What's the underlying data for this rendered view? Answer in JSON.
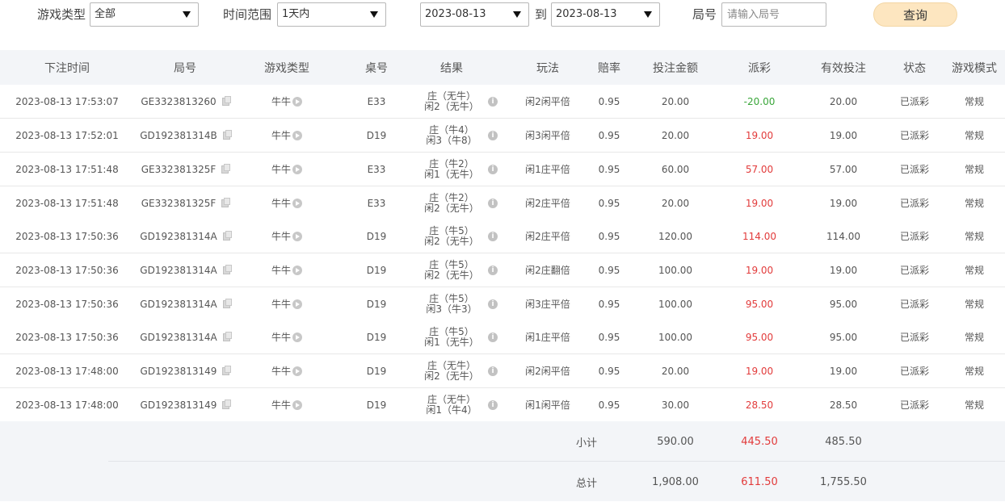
{
  "filters": {
    "game_type_label": "游戏类型",
    "game_type_value": "全部",
    "time_range_label": "时间范围",
    "time_range_value": "1天内",
    "date_from": "2023-08-13",
    "to_label": "到",
    "date_to": "2023-08-13",
    "round_label": "局号",
    "round_placeholder": "请输入局号",
    "query_button": "查询"
  },
  "table": {
    "headers": {
      "time": "下注时间",
      "round": "局号",
      "game": "游戏类型",
      "table": "桌号",
      "result": "结果",
      "play": "玩法",
      "odds": "赔率",
      "bet": "投注金额",
      "payout": "派彩",
      "valid": "有效投注",
      "status": "状态",
      "mode": "游戏模式"
    },
    "rows": [
      {
        "time": "2023-08-13 17:53:07",
        "round": "GE3323813260",
        "game": "牛牛",
        "table": "E33",
        "result1": "庄（无牛）",
        "result2": "闲2（无牛）",
        "play": "闲2闲平倍",
        "odds": "0.95",
        "bet": "20.00",
        "payout": "-20.00",
        "valid": "20.00",
        "status": "已派彩",
        "mode": "常规"
      },
      {
        "time": "2023-08-13 17:52:01",
        "round": "GD192381314B",
        "game": "牛牛",
        "table": "D19",
        "result1": "庄（牛4）",
        "result2": "闲3（牛8）",
        "play": "闲3闲平倍",
        "odds": "0.95",
        "bet": "20.00",
        "payout": "19.00",
        "valid": "19.00",
        "status": "已派彩",
        "mode": "常规"
      },
      {
        "time": "2023-08-13 17:51:48",
        "round": "GE332381325F",
        "game": "牛牛",
        "table": "E33",
        "result1": "庄（牛2）",
        "result2": "闲1（无牛）",
        "play": "闲1庄平倍",
        "odds": "0.95",
        "bet": "60.00",
        "payout": "57.00",
        "valid": "57.00",
        "status": "已派彩",
        "mode": "常规"
      },
      {
        "time": "2023-08-13 17:51:48",
        "round": "GE332381325F",
        "game": "牛牛",
        "table": "E33",
        "result1": "庄（牛2）",
        "result2": "闲2（无牛）",
        "play": "闲2庄平倍",
        "odds": "0.95",
        "bet": "20.00",
        "payout": "19.00",
        "valid": "19.00",
        "status": "已派彩",
        "mode": "常规"
      },
      {
        "time": "2023-08-13 17:50:36",
        "round": "GD192381314A",
        "game": "牛牛",
        "table": "D19",
        "result1": "庄（牛5）",
        "result2": "闲2（无牛）",
        "play": "闲2庄平倍",
        "odds": "0.95",
        "bet": "120.00",
        "payout": "114.00",
        "valid": "114.00",
        "status": "已派彩",
        "mode": "常规"
      },
      {
        "time": "2023-08-13 17:50:36",
        "round": "GD192381314A",
        "game": "牛牛",
        "table": "D19",
        "result1": "庄（牛5）",
        "result2": "闲2（无牛）",
        "play": "闲2庄翻倍",
        "odds": "0.95",
        "bet": "100.00",
        "payout": "19.00",
        "valid": "19.00",
        "status": "已派彩",
        "mode": "常规"
      },
      {
        "time": "2023-08-13 17:50:36",
        "round": "GD192381314A",
        "game": "牛牛",
        "table": "D19",
        "result1": "庄（牛5）",
        "result2": "闲3（牛3）",
        "play": "闲3庄平倍",
        "odds": "0.95",
        "bet": "100.00",
        "payout": "95.00",
        "valid": "95.00",
        "status": "已派彩",
        "mode": "常规"
      },
      {
        "time": "2023-08-13 17:50:36",
        "round": "GD192381314A",
        "game": "牛牛",
        "table": "D19",
        "result1": "庄（牛5）",
        "result2": "闲1（无牛）",
        "play": "闲1庄平倍",
        "odds": "0.95",
        "bet": "100.00",
        "payout": "95.00",
        "valid": "95.00",
        "status": "已派彩",
        "mode": "常规"
      },
      {
        "time": "2023-08-13 17:48:00",
        "round": "GD1923813149",
        "game": "牛牛",
        "table": "D19",
        "result1": "庄（无牛）",
        "result2": "闲2（无牛）",
        "play": "闲2闲平倍",
        "odds": "0.95",
        "bet": "20.00",
        "payout": "19.00",
        "valid": "19.00",
        "status": "已派彩",
        "mode": "常规"
      },
      {
        "time": "2023-08-13 17:48:00",
        "round": "GD1923813149",
        "game": "牛牛",
        "table": "D19",
        "result1": "庄（无牛）",
        "result2": "闲1（牛4）",
        "play": "闲1闲平倍",
        "odds": "0.95",
        "bet": "30.00",
        "payout": "28.50",
        "valid": "28.50",
        "status": "已派彩",
        "mode": "常规"
      }
    ]
  },
  "summary": {
    "subtotal_label": "小计",
    "subtotal_bet": "590.00",
    "subtotal_payout": "445.50",
    "subtotal_valid": "485.50",
    "total_label": "总计",
    "total_bet": "1,908.00",
    "total_payout": "611.50",
    "total_valid": "1,755.50"
  },
  "icons": {
    "copy": "copy-icon",
    "play": "play-circle-icon",
    "info": "info-icon",
    "dropdown": "chevron-down-icon"
  },
  "colors": {
    "positive_payout": "#e23b3b",
    "negative_payout": "#3aa63a",
    "query_button_bg": "#fde6c0",
    "header_bg": "#f3f5f8"
  }
}
